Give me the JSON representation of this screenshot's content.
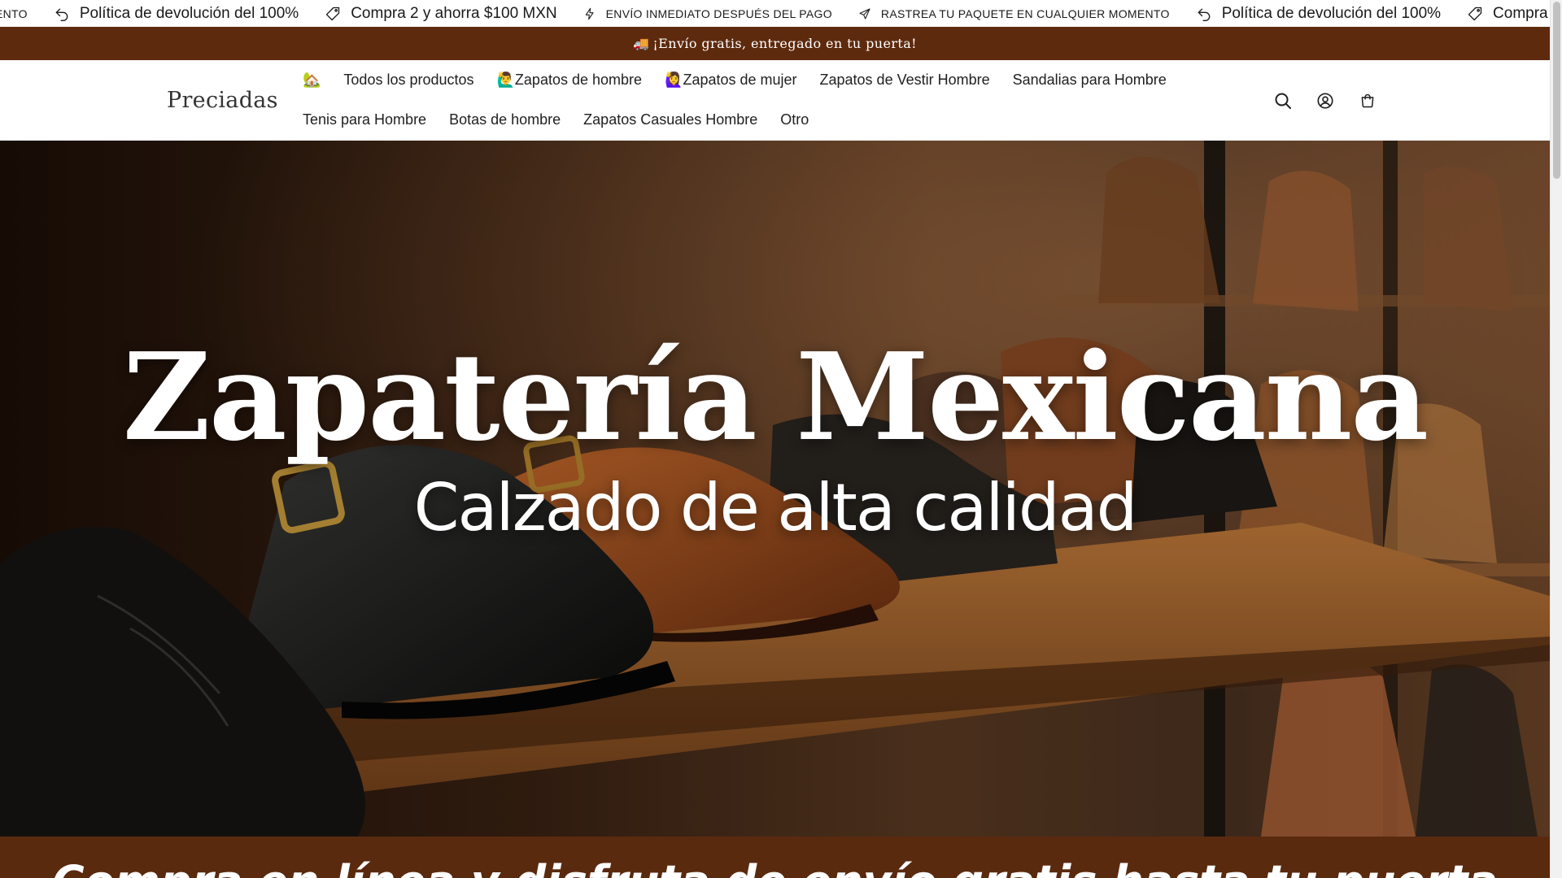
{
  "marquee": {
    "items": [
      {
        "icon": "truck-icon",
        "text": "ENTO",
        "style": "small"
      },
      {
        "icon": "return-arrow-icon",
        "text": "Política de devolución del 100%",
        "style": "big"
      },
      {
        "icon": "price-tag-icon",
        "text": "Compra 2 y ahorra $100 MXN",
        "style": "big"
      },
      {
        "icon": "lightning-icon",
        "text": "ENVÍO INMEDIATO DESPUÉS DEL PAGO",
        "style": "small"
      },
      {
        "icon": "airplane-icon",
        "text": "RASTREA TU PAQUETE EN CUALQUIER MOMENTO",
        "style": "small"
      },
      {
        "icon": "return-arrow-icon",
        "text": "Política de devolución del 100%",
        "style": "big"
      },
      {
        "icon": "price-tag-icon",
        "text": "Compra",
        "style": "big"
      }
    ]
  },
  "announcement": {
    "emoji": "🚚",
    "text": "¡Envío gratis, entregado en tu puerta!"
  },
  "header": {
    "logo": "Preciadas",
    "nav_row1": [
      {
        "label": "🏡",
        "name": "nav-home"
      },
      {
        "label": "Todos los productos",
        "name": "nav-all-products"
      },
      {
        "label": "🙋‍♂️Zapatos de hombre",
        "name": "nav-mens-shoes"
      },
      {
        "label": "🙋‍♀️Zapatos de mujer",
        "name": "nav-womens-shoes"
      },
      {
        "label": "Zapatos de Vestir Hombre",
        "name": "nav-mens-dress-shoes"
      },
      {
        "label": "Sandalias para Hombre",
        "name": "nav-mens-sandals"
      }
    ],
    "nav_row2": [
      {
        "label": "Tenis para Hombre",
        "name": "nav-mens-sneakers"
      },
      {
        "label": "Botas de hombre",
        "name": "nav-mens-boots"
      },
      {
        "label": "Zapatos Casuales Hombre",
        "name": "nav-mens-casual"
      },
      {
        "label": "Otro",
        "name": "nav-other"
      }
    ],
    "icons": [
      "search-icon",
      "account-icon",
      "cart-icon"
    ]
  },
  "hero": {
    "title": "Zapatería Mexicana",
    "subtitle": "Calzado de alta calidad"
  },
  "banner": {
    "text": "Compra en línea y disfruta de envío gratis hasta tu puerta"
  },
  "colors": {
    "brand_brown": "#5e2a0e",
    "text": "#1f1f1f",
    "white": "#ffffff"
  }
}
